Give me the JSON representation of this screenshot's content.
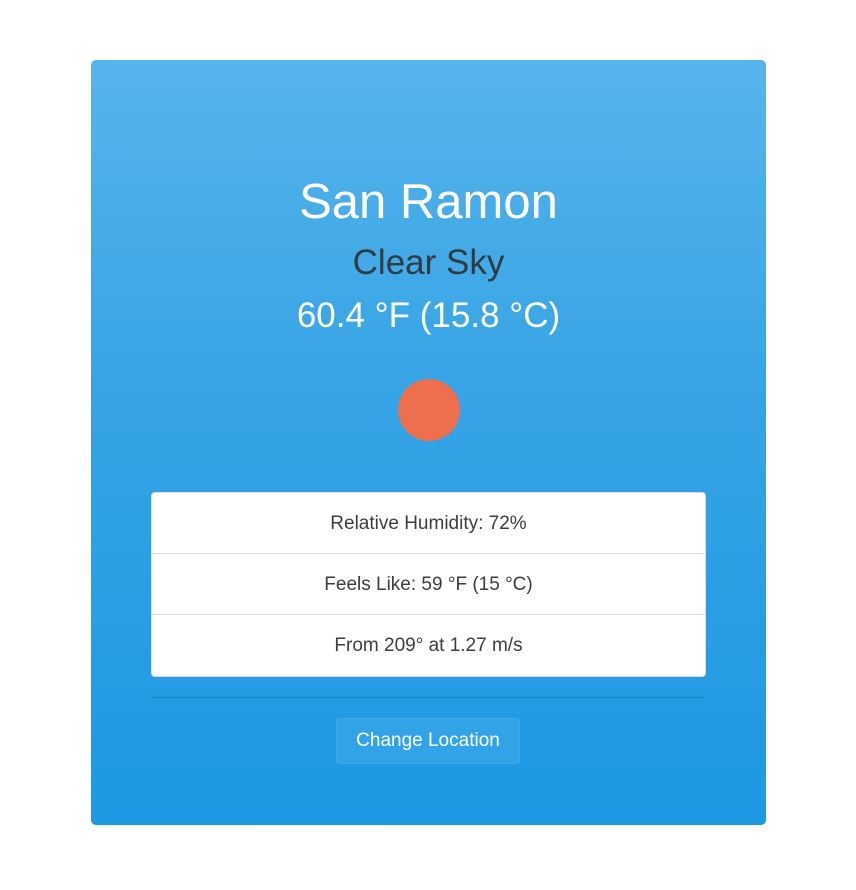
{
  "weather": {
    "city": "San Ramon",
    "condition": "Clear Sky",
    "temperature": "60.4 °F (15.8 °C)",
    "icon": "sun-icon",
    "icon_color": "#ee6f4d"
  },
  "details": [
    {
      "label": "Relative Humidity: 72%"
    },
    {
      "label": "Feels Like: 59 °F (15 °C)"
    },
    {
      "label": "From 209° at 1.27 m/s"
    }
  ],
  "actions": {
    "change_location_label": "Change Location"
  },
  "colors": {
    "card_top": "#55b4ea",
    "card_bottom": "#1d98e3",
    "text_light": "#ffffff",
    "text_dark": "#2f3b45"
  }
}
